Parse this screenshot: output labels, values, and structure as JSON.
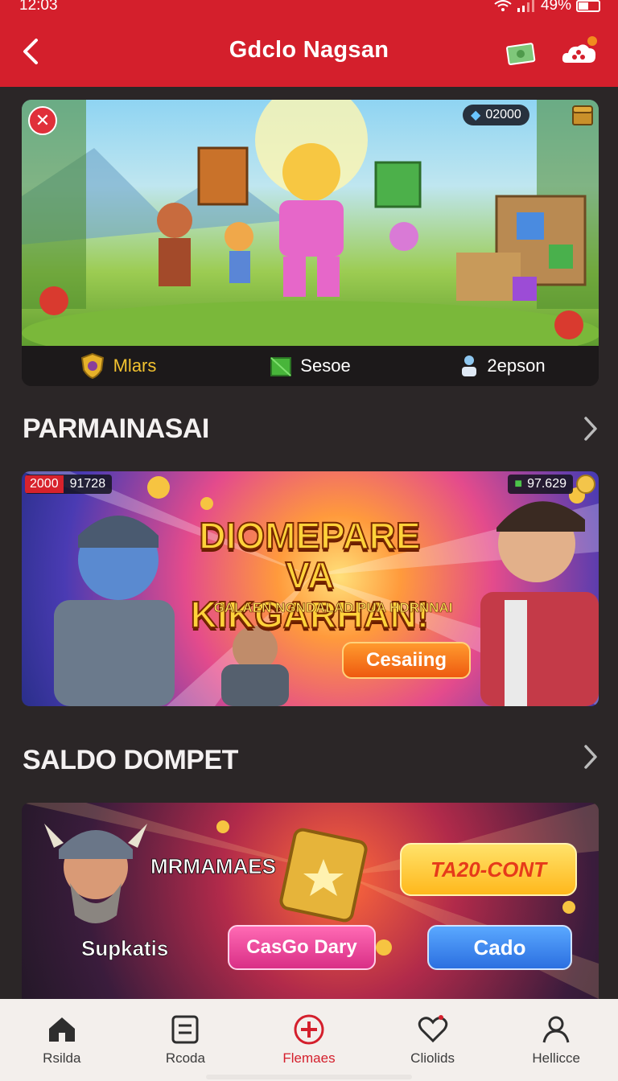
{
  "status": {
    "time": "12:03",
    "battery": "49%"
  },
  "header": {
    "title": "Gdclo Nagsan"
  },
  "banner1": {
    "counter": "02000",
    "tabs": [
      {
        "label": "Mlars",
        "icon": "shield-icon"
      },
      {
        "label": "Sesoe",
        "icon": "cube-icon"
      },
      {
        "label": "2epson",
        "icon": "person-icon"
      }
    ]
  },
  "section1": {
    "title": "PARMAINASAI"
  },
  "banner2": {
    "badge": "2000",
    "left_value": "91728",
    "right_value": "97.629",
    "headline_line1": "DIOMEPARE",
    "headline_line2": "VA KIKGARHAN!",
    "subtitle": "GALAEN NGNDALAD PUA HDRNNAI",
    "button": "Cesaiing"
  },
  "section2": {
    "title": "SALDO DOMPET"
  },
  "banner3": {
    "name": "MRMAMAES",
    "caption": "Supkatis",
    "bubble": "TA20-CONT",
    "button_pink": "CasGo Dary",
    "button_blue": "Cado"
  },
  "bottomnav": {
    "items": [
      {
        "label": "Rsilda",
        "icon": "home-icon"
      },
      {
        "label": "Rcoda",
        "icon": "card-icon"
      },
      {
        "label": "Flemaes",
        "icon": "plus-circle-icon",
        "active": true
      },
      {
        "label": "Cliolids",
        "icon": "heart-icon"
      },
      {
        "label": "Hellicce",
        "icon": "profile-icon"
      }
    ]
  },
  "colors": {
    "brand": "#d41f2c",
    "background": "#2b2627",
    "nav_bg": "#f3efec"
  }
}
